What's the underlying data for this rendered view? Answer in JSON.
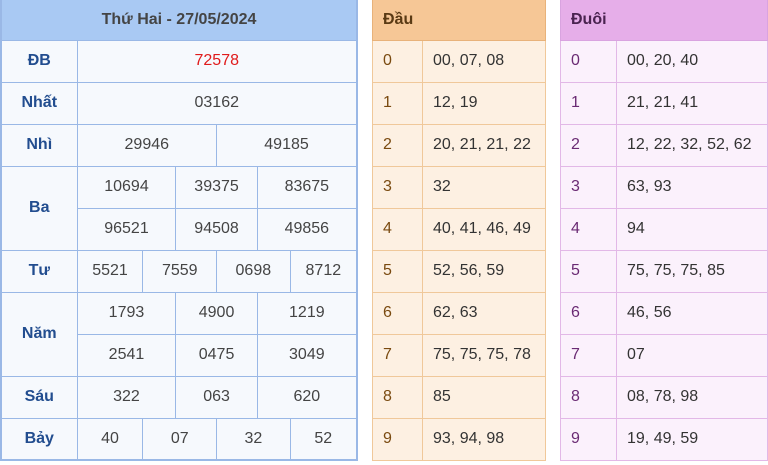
{
  "results": {
    "header": "Thứ Hai - 27/05/2024",
    "rows": {
      "db": {
        "label": "ĐB",
        "values": [
          "72578"
        ]
      },
      "nhat": {
        "label": "Nhất",
        "values": [
          "03162"
        ]
      },
      "nhi": {
        "label": "Nhì",
        "values": [
          "29946",
          "49185"
        ]
      },
      "ba": {
        "label": "Ba",
        "values": [
          "10694",
          "39375",
          "83675",
          "96521",
          "94508",
          "49856"
        ]
      },
      "tu": {
        "label": "Tư",
        "values": [
          "5521",
          "7559",
          "0698",
          "8712"
        ]
      },
      "nam": {
        "label": "Năm",
        "values": [
          "1793",
          "4900",
          "1219",
          "2541",
          "0475",
          "3049"
        ]
      },
      "sau": {
        "label": "Sáu",
        "values": [
          "322",
          "063",
          "620"
        ]
      },
      "bay": {
        "label": "Bảy",
        "values": [
          "40",
          "07",
          "32",
          "52"
        ]
      }
    }
  },
  "dau": {
    "header": "Đầu",
    "rows": [
      {
        "k": "0",
        "v": "00, 07, 08"
      },
      {
        "k": "1",
        "v": "12, 19"
      },
      {
        "k": "2",
        "v": "20, 21, 21, 22"
      },
      {
        "k": "3",
        "v": "32"
      },
      {
        "k": "4",
        "v": "40, 41, 46, 49"
      },
      {
        "k": "5",
        "v": "52, 56, 59"
      },
      {
        "k": "6",
        "v": "62, 63"
      },
      {
        "k": "7",
        "v": "75, 75, 75, 78"
      },
      {
        "k": "8",
        "v": "85"
      },
      {
        "k": "9",
        "v": "93, 94, 98"
      }
    ]
  },
  "duoi": {
    "header": "Đuôi",
    "rows": [
      {
        "k": "0",
        "v": "00, 20, 40"
      },
      {
        "k": "1",
        "v": "21, 21, 41"
      },
      {
        "k": "2",
        "v": "12, 22, 32, 52, 62"
      },
      {
        "k": "3",
        "v": "63, 93"
      },
      {
        "k": "4",
        "v": "94"
      },
      {
        "k": "5",
        "v": "75, 75, 75, 85"
      },
      {
        "k": "6",
        "v": "46, 56"
      },
      {
        "k": "7",
        "v": "07"
      },
      {
        "k": "8",
        "v": "08, 78, 98"
      },
      {
        "k": "9",
        "v": "19, 49, 59"
      }
    ]
  }
}
